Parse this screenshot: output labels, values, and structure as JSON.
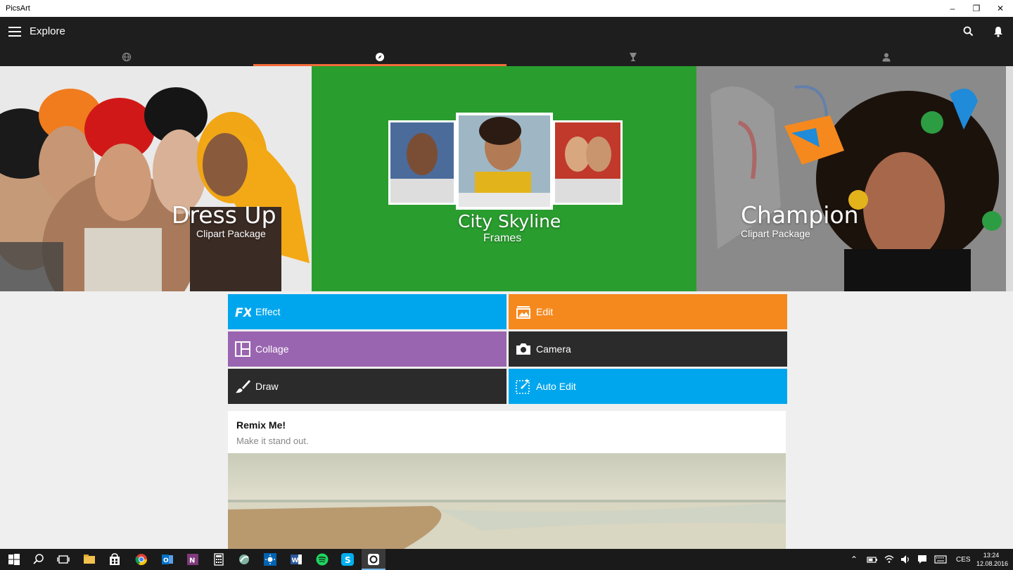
{
  "window": {
    "title": "PicsArt",
    "minimize": "–",
    "maximize": "❐",
    "close": "✕"
  },
  "appbar": {
    "title": "Explore"
  },
  "tabs": [
    {
      "icon": "globe-icon"
    },
    {
      "icon": "compass-icon",
      "active": true
    },
    {
      "icon": "trophy-icon"
    },
    {
      "icon": "person-icon"
    }
  ],
  "hero": [
    {
      "title": "Dress Up",
      "subtitle": "Clipart Package"
    },
    {
      "title": "City Skyline",
      "subtitle": "Frames"
    },
    {
      "title": "Champion",
      "subtitle": "Clipart Package"
    }
  ],
  "tools": [
    {
      "label": "Effect",
      "color": "#00a6ed",
      "icon": "fx-icon"
    },
    {
      "label": "Edit",
      "color": "#f5891e",
      "icon": "image-edit-icon"
    },
    {
      "label": "Collage",
      "color": "#9a65b0",
      "icon": "collage-icon"
    },
    {
      "label": "Camera",
      "color": "#2b2b2b",
      "icon": "camera-icon"
    },
    {
      "label": "Draw",
      "color": "#2b2b2b",
      "icon": "brush-icon"
    },
    {
      "label": "Auto Edit",
      "color": "#00a6ed",
      "icon": "magic-wand-icon"
    }
  ],
  "remix": {
    "title": "Remix Me!",
    "subtitle": "Make it stand out."
  },
  "taskbar": {
    "language": "CES",
    "time": "13:24",
    "date": "12.08.2016"
  },
  "colors": {
    "accent": "#f26b3a",
    "green": "#2a9d2f",
    "appbar": "#1e1e1e"
  }
}
